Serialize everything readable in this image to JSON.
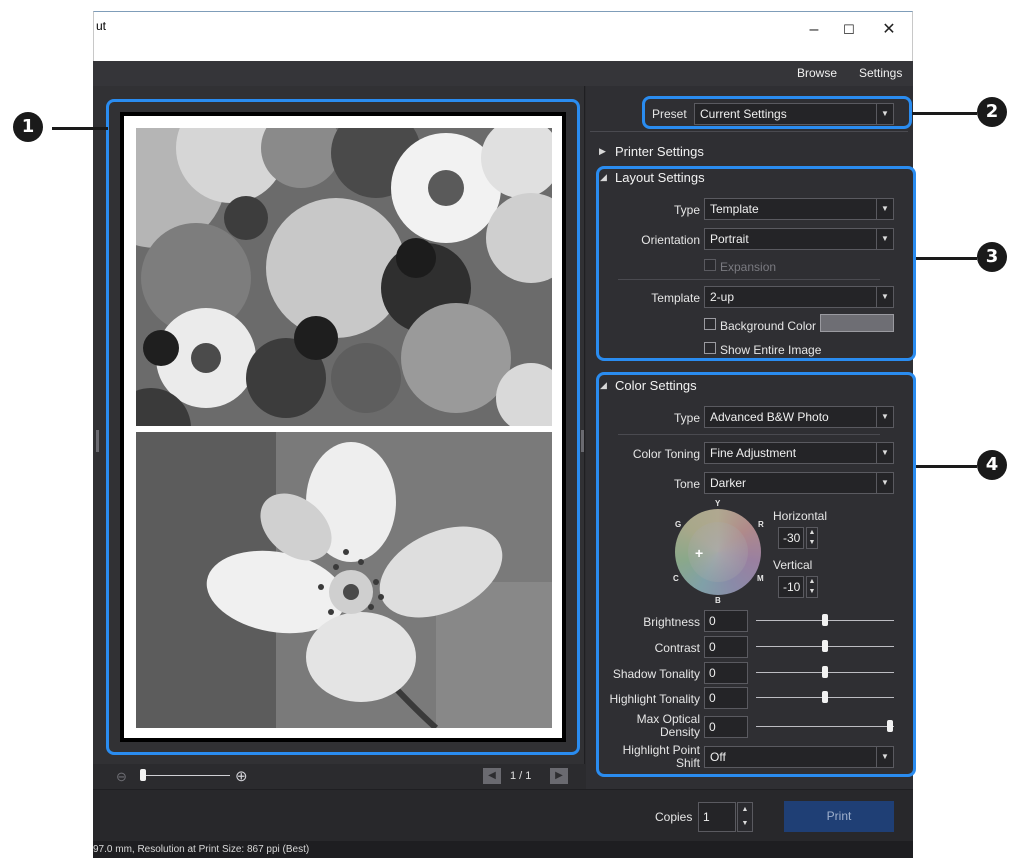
{
  "window": {
    "title": "ut",
    "minimize": "–",
    "maximize": "☐",
    "close": "✕"
  },
  "menu": {
    "browse": "Browse",
    "settings": "Settings"
  },
  "preset": {
    "label": "Preset",
    "value": "Current Settings"
  },
  "printer_settings": {
    "label": "Printer Settings"
  },
  "layout_settings": {
    "label": "Layout Settings",
    "type_label": "Type",
    "type_value": "Template",
    "orientation_label": "Orientation",
    "orientation_value": "Portrait",
    "expansion_label": "Expansion",
    "template_label": "Template",
    "template_value": "2-up",
    "background_color_label": "Background Color",
    "show_entire_image_label": "Show Entire Image"
  },
  "color_settings": {
    "label": "Color Settings",
    "type_label": "Type",
    "type_value": "Advanced B&W Photo",
    "color_toning_label": "Color Toning",
    "color_toning_value": "Fine Adjustment",
    "tone_label": "Tone",
    "tone_value": "Darker",
    "wheel_labels": {
      "y": "Y",
      "r": "R",
      "m": "M",
      "b": "B",
      "c": "C",
      "g": "G"
    },
    "horizontal_label": "Horizontal",
    "horizontal_value": "-30",
    "vertical_label": "Vertical",
    "vertical_value": "-10",
    "brightness_label": "Brightness",
    "brightness_value": "0",
    "contrast_label": "Contrast",
    "contrast_value": "0",
    "shadow_tonality_label": "Shadow Tonality",
    "shadow_tonality_value": "0",
    "highlight_tonality_label": "Highlight Tonality",
    "highlight_tonality_value": "0",
    "max_optical_density_label_1": "Max Optical",
    "max_optical_density_label_2": "Density",
    "max_optical_density_value": "0",
    "highlight_point_shift_label_1": "Highlight Point",
    "highlight_point_shift_label_2": "Shift",
    "highlight_point_shift_value": "Off"
  },
  "preview": {
    "page_indicator": "1 / 1"
  },
  "bottom": {
    "copies_label": "Copies",
    "copies_value": "1",
    "print_label": "Print"
  },
  "status": {
    "text": "97.0 mm,   Resolution at Print Size: 867 ppi (Best)"
  },
  "callouts": [
    "1",
    "2",
    "3",
    "4"
  ],
  "colors": {
    "callout_blue": "#2a8cf0",
    "print_button": "#1f3f75",
    "panel_bg": "#2f2f33"
  }
}
